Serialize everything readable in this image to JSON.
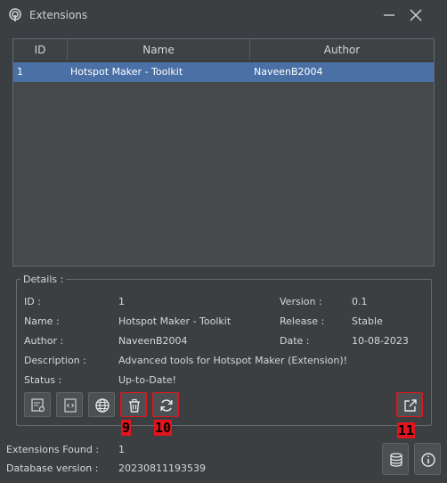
{
  "window": {
    "title": "Extensions"
  },
  "table": {
    "columns": [
      "ID",
      "Name",
      "Author"
    ],
    "rows": [
      {
        "id": "1",
        "name": "Hotspot Maker - Toolkit",
        "author": "NaveenB2004",
        "selected": true
      }
    ]
  },
  "details": {
    "legend": "Details :",
    "id_label": "ID :",
    "id_value": "1",
    "name_label": "Name :",
    "name_value": "Hotspot Maker - Toolkit",
    "author_label": "Author :",
    "author_value": "NaveenB2004",
    "description_label": "Description :",
    "description_value": "Advanced tools for Hotspot Maker (Extension)!",
    "status_label": "Status :",
    "status_value": "Up-to-Date!",
    "version_label": "Version :",
    "version_value": "0.1",
    "release_label": "Release :",
    "release_value": "Stable",
    "date_label": "Date :",
    "date_value": "10-08-2023"
  },
  "toolbar": {
    "buttons": [
      "certificate-icon",
      "code-icon",
      "globe-icon",
      "trash-icon",
      "refresh-icon",
      "external-link-icon"
    ]
  },
  "badges": {
    "delete": "9",
    "update": "10",
    "open": "11"
  },
  "footer": {
    "extensions_found_label": "Extensions Found :",
    "extensions_found_value": "1",
    "database_version_label": "Database version :",
    "database_version_value": "20230811193539"
  },
  "colors": {
    "selection": "#4a70a6",
    "highlight": "#e0161f",
    "background": "#3c3f41"
  }
}
